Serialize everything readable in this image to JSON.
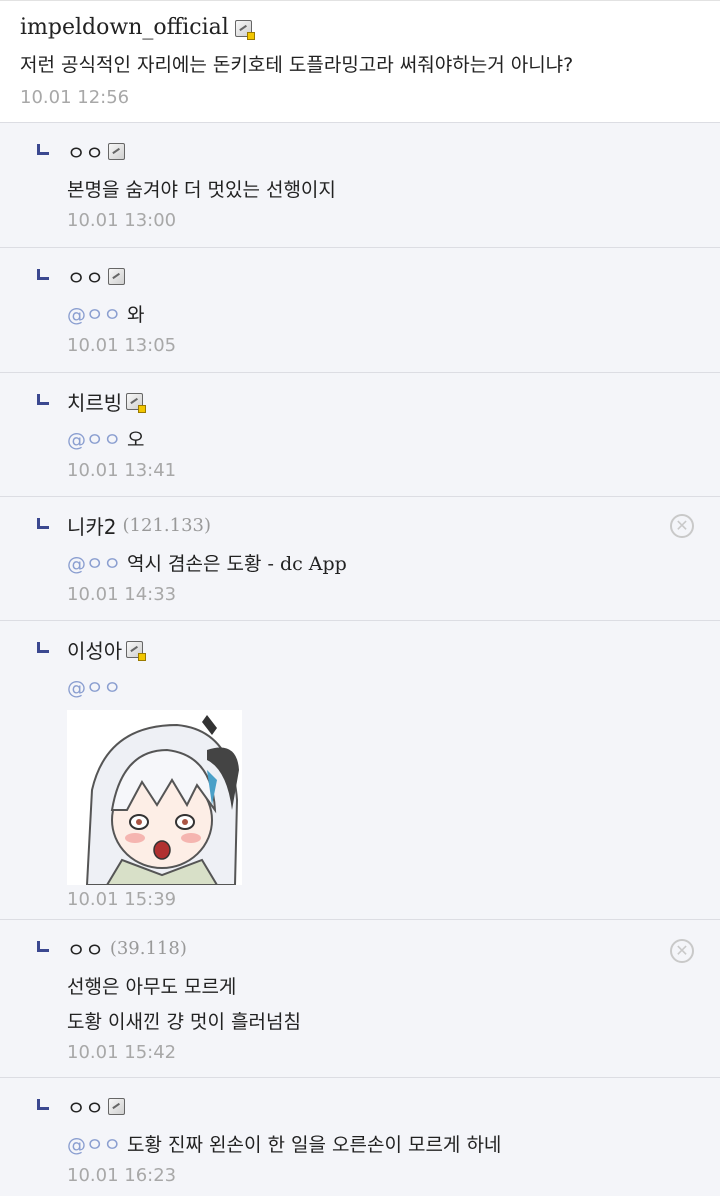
{
  "post": {
    "nick": "impeldown_official",
    "text": "저런 공식적인 자리에는 돈키호테 도플라밍고라 써줘야하는거 아니냐?",
    "date": "10.01 12:56"
  },
  "replies": [
    {
      "nick": "ㅇㅇ",
      "mention": "",
      "text": "본명을 숨겨야 더 멋있는 선행이지",
      "date": "10.01 13:00"
    },
    {
      "nick": "ㅇㅇ",
      "mention": "@ㅇㅇ",
      "text": "와",
      "date": "10.01 13:05"
    },
    {
      "nick": "치르빙",
      "mention": "@ㅇㅇ",
      "text": "오",
      "date": "10.01 13:41"
    },
    {
      "nick": "니카2",
      "ip": "(121.133)",
      "mention": "@ㅇㅇ",
      "text": "역시 겸손은 도황 - dc App",
      "date": "10.01 14:33"
    },
    {
      "nick": "이성아",
      "mention": "@ㅇㅇ",
      "text": "",
      "date": "10.01 15:39"
    },
    {
      "nick": "ㅇㅇ",
      "ip": "(39.118)",
      "mention": "",
      "text1": "선행은 아무도 모르게",
      "text2": "도황 이새낀 걍 멋이 흘러넘침",
      "date": "10.01 15:42"
    },
    {
      "nick": "ㅇㅇ",
      "mention": "@ㅇㅇ",
      "text": "도황 진짜 왼손이 한 일을 오른손이 모르게 하네",
      "date": "10.01 16:23"
    }
  ],
  "icons": {
    "delete": "close-circle-icon",
    "reply_arrow": "reply-arrow-icon",
    "gallog": "gallog-icon"
  },
  "colors": {
    "mention": "#8a9ed0",
    "arrow": "#3b4890",
    "reply_bg": "#f4f5f9"
  }
}
